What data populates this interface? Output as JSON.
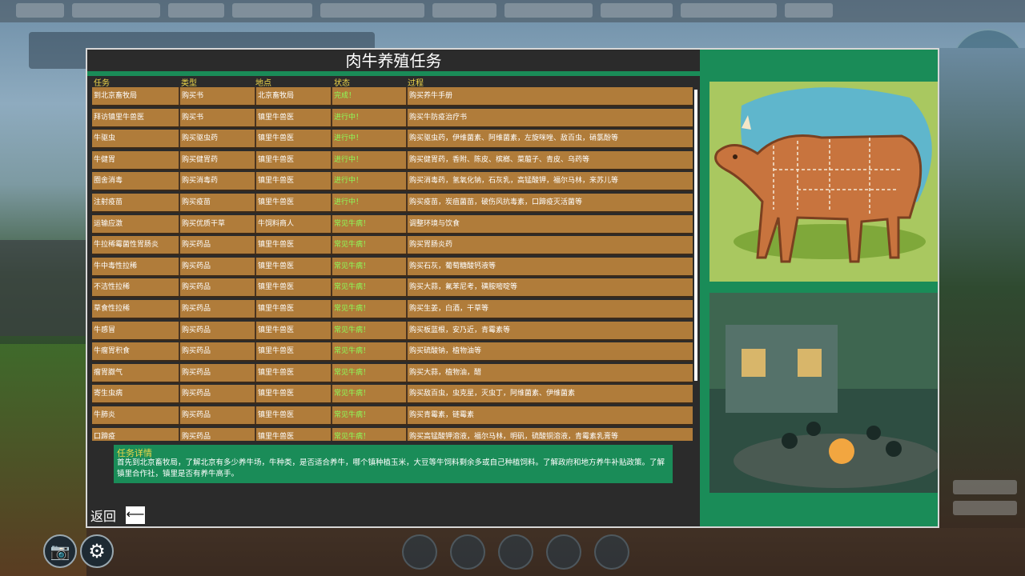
{
  "window_title": "肉牛养殖任务",
  "columns": {
    "task": "任务",
    "type": "类型",
    "location": "地点",
    "status": "状态",
    "process": "过程"
  },
  "rows": [
    {
      "task": "到北京畜牧局",
      "type": "购买书",
      "location": "北京畜牧局",
      "status": "完成！",
      "process": "购买养牛手册"
    },
    {
      "task": "拜访镇里牛兽医",
      "type": "购买书",
      "location": "镇里牛兽医",
      "status": "进行中！",
      "process": "购买牛防疫治疗书"
    },
    {
      "task": "牛驱虫",
      "type": "购买驱虫药",
      "location": "镇里牛兽医",
      "status": "进行中！",
      "process": "购买驱虫药，伊维菌素、阿维菌素，左旋咪唑、敌百虫，硝氯酚等"
    },
    {
      "task": "牛健胃",
      "type": "购买健胃药",
      "location": "镇里牛兽医",
      "status": "进行中！",
      "process": "购买健胃药，香附、陈皮、槟榔、菜菔子、青皮、乌药等"
    },
    {
      "task": "圈舍消毒",
      "type": "购买消毒药",
      "location": "镇里牛兽医",
      "status": "进行中！",
      "process": "购买消毒药，氢氧化钠，石灰乳，高锰酸钾，福尔马林，来苏儿等"
    },
    {
      "task": "注射疫苗",
      "type": "购买疫苗",
      "location": "镇里牛兽医",
      "status": "进行中！",
      "process": "购买疫苗，炭疽菌苗，破伤风抗毒素，口蹄疫灭活菌等"
    },
    {
      "task": "运输应激",
      "type": "购买优质干草",
      "location": "牛饲料商人",
      "status": "常见牛病！",
      "process": "调整环境与饮食"
    },
    {
      "task": "牛拉稀霉菌性胃肠炎",
      "type": "购买药品",
      "location": "镇里牛兽医",
      "status": "常见牛病！",
      "process": "购买胃肠炎药"
    },
    {
      "task": "牛中毒性拉稀",
      "type": "购买药品",
      "location": "镇里牛兽医",
      "status": "常见牛病！",
      "process": "购买石灰，葡萄糖酸钙液等"
    },
    {
      "task": "不洁性拉稀",
      "type": "购买药品",
      "location": "镇里牛兽医",
      "status": "常见牛病！",
      "process": "购买大蒜，氟苯尼考，磺胺嘧啶等"
    },
    {
      "task": "草食性拉稀",
      "type": "购买药品",
      "location": "镇里牛兽医",
      "status": "常见牛病！",
      "process": "购买生姜，白酒，干草等"
    },
    {
      "task": "牛感冒",
      "type": "购买药品",
      "location": "镇里牛兽医",
      "status": "常见牛病！",
      "process": "购买板蓝根，安乃近，青霉素等"
    },
    {
      "task": "牛瘤胃积食",
      "type": "购买药品",
      "location": "镇里牛兽医",
      "status": "常见牛病！",
      "process": "购买硫酸钠，植物油等"
    },
    {
      "task": "瘤胃臌气",
      "type": "购买药品",
      "location": "镇里牛兽医",
      "status": "常见牛病！",
      "process": "购买大蒜，植物油，醋"
    },
    {
      "task": "寄生虫病",
      "type": "购买药品",
      "location": "镇里牛兽医",
      "status": "常见牛病！",
      "process": "购买敌百虫，虫克星，灭虫丁，阿维菌素、伊维菌素"
    },
    {
      "task": "牛肺炎",
      "type": "购买药品",
      "location": "镇里牛兽医",
      "status": "常见牛病！",
      "process": "购买青霉素，链霉素"
    },
    {
      "task": "口蹄疫",
      "type": "购买药品",
      "location": "镇里牛兽医",
      "status": "常见牛病！",
      "process": "购买高锰酸钾溶液，福尔马林，明矾，硫酸铜溶液，青霉素乳膏等"
    }
  ],
  "detail": {
    "title": "任务详情",
    "text": "首先到北京畜牧局，了解北京有多少养牛场，牛种类，是否适合养牛，哪个镇种植玉米，大豆等牛饲料剩余多或自己种植饲料。了解政府和地方养牛补贴政策。了解镇里合作社，镇里是否有养牛高手。"
  },
  "back_label": "返回",
  "icons": {
    "back": "arrow-left-icon",
    "camera": "camera-icon",
    "settings": "gear-icon"
  },
  "colors": {
    "row_bg": "#b07c3a",
    "accent_green": "#1a8c58",
    "header_yellow": "#f0d84a",
    "status_green": "#8cff5a",
    "panel_dark": "#2b2b2b"
  }
}
